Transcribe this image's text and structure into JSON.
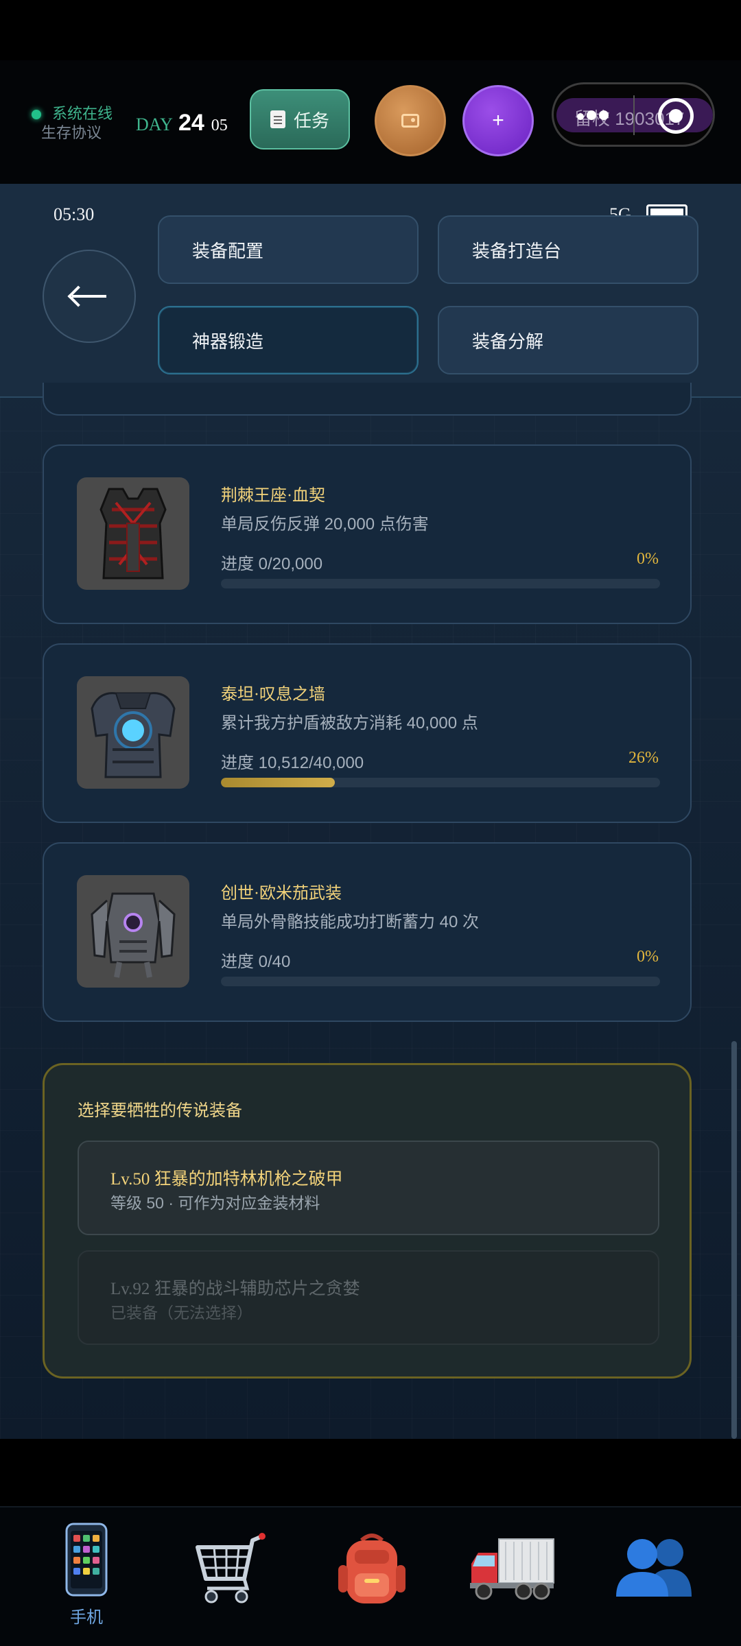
{
  "hud": {
    "status_line1": "系统在线",
    "status_line2": "生存协议",
    "day_label": "DAY",
    "day_number": "24",
    "day_sub": "05",
    "task_button": "任务",
    "capsule_text": "留校 1903017"
  },
  "statusbar": {
    "time": "05:30",
    "network": "5G"
  },
  "tabs": [
    {
      "label": "装备配置",
      "active": false
    },
    {
      "label": "装备打造台",
      "active": false
    },
    {
      "label": "神器锻造",
      "active": true
    },
    {
      "label": "装备分解",
      "active": false
    }
  ],
  "artifacts": [
    {
      "name": "荆棘王座·血契",
      "desc": "单局反伤反弹 20,000 点伤害",
      "progress": "进度 0/20,000",
      "percent": "0%",
      "fraction": 0.0
    },
    {
      "name": "泰坦·叹息之墙",
      "desc": "累计我方护盾被敌方消耗 40,000 点",
      "progress": "进度 10,512/40,000",
      "percent": "26%",
      "fraction": 0.26
    },
    {
      "name": "创世·欧米茄武装",
      "desc": "单局外骨骼技能成功打断蓄力 40 次",
      "progress": "进度 0/40",
      "percent": "0%",
      "fraction": 0.0
    }
  ],
  "sacrifice": {
    "title": "选择要牺牲的传说装备",
    "options": [
      {
        "title": "Lv.50 狂暴的加特林机枪之破甲",
        "sub": "等级 50 · 可作为对应金装材料",
        "disabled": false
      },
      {
        "title": "Lv.92 狂暴的战斗辅助芯片之贪婪",
        "sub": "已装备（无法选择）",
        "disabled": true
      }
    ]
  },
  "nav": {
    "phone_label": "手机"
  },
  "colors": {
    "accent_gold": "#f3d37a",
    "progress_gold": "#d0ad4a",
    "task_green": "#3d8f79",
    "plus_purple": "#7a2fd6"
  }
}
